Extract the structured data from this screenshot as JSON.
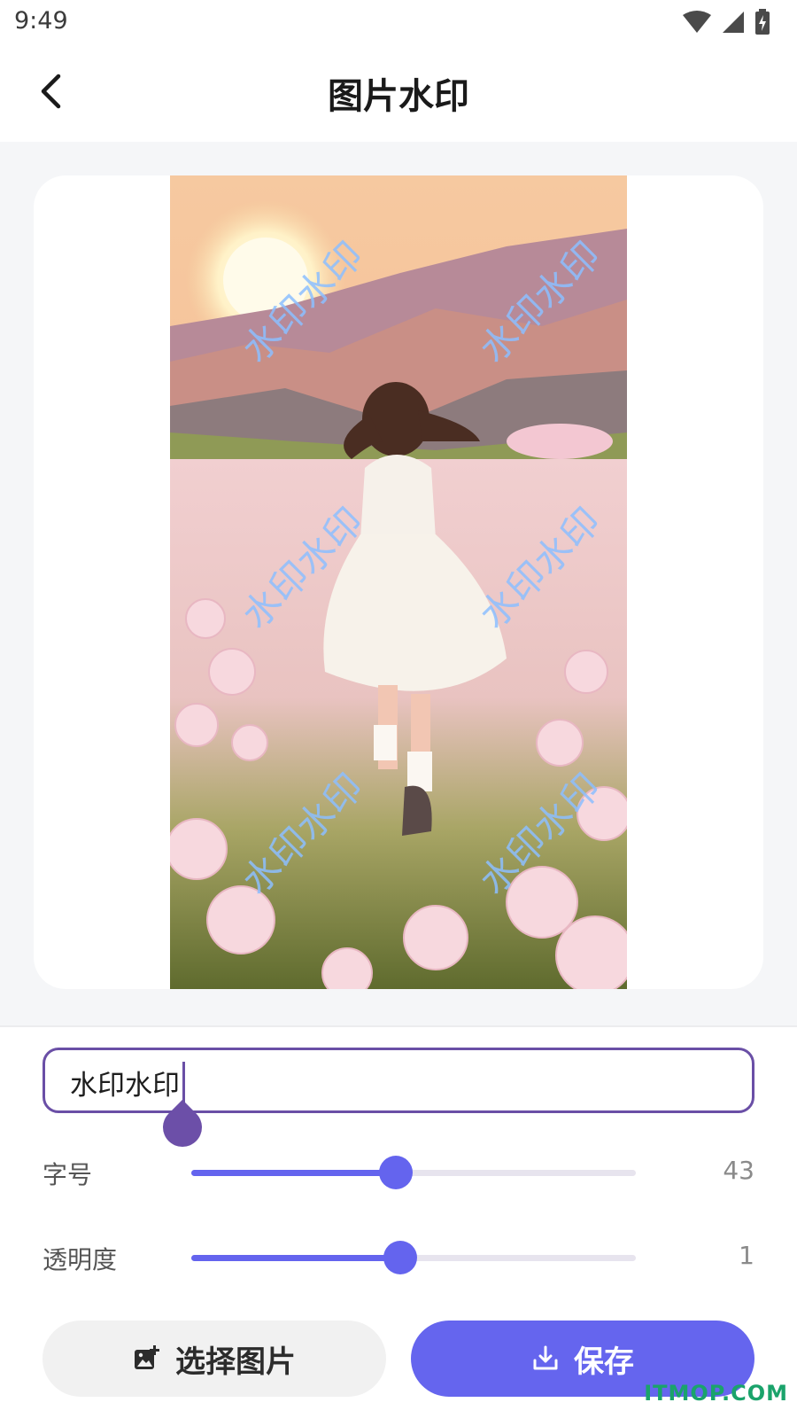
{
  "status_bar": {
    "time": "9:49",
    "tag": "c7i"
  },
  "header": {
    "title": "图片水印"
  },
  "preview": {
    "watermark_text": "水印水印",
    "watermark_color": "#8cbeff"
  },
  "editor": {
    "input_value": "水印水印",
    "accent_color": "#6a4fa6"
  },
  "sliders": [
    {
      "label": "字号",
      "value": "43",
      "level": 0.46
    },
    {
      "label": "透明度",
      "value": "1",
      "level": 0.47
    }
  ],
  "buttons": {
    "select_label": "选择图片",
    "save_label": "保存",
    "save_color": "#6565ee"
  },
  "corner_brand": "ITMOP.COM",
  "icons": [
    "back-arrow-icon",
    "wifi-icon",
    "signal-icon",
    "battery-icon",
    "add-image-icon",
    "download-icon"
  ]
}
